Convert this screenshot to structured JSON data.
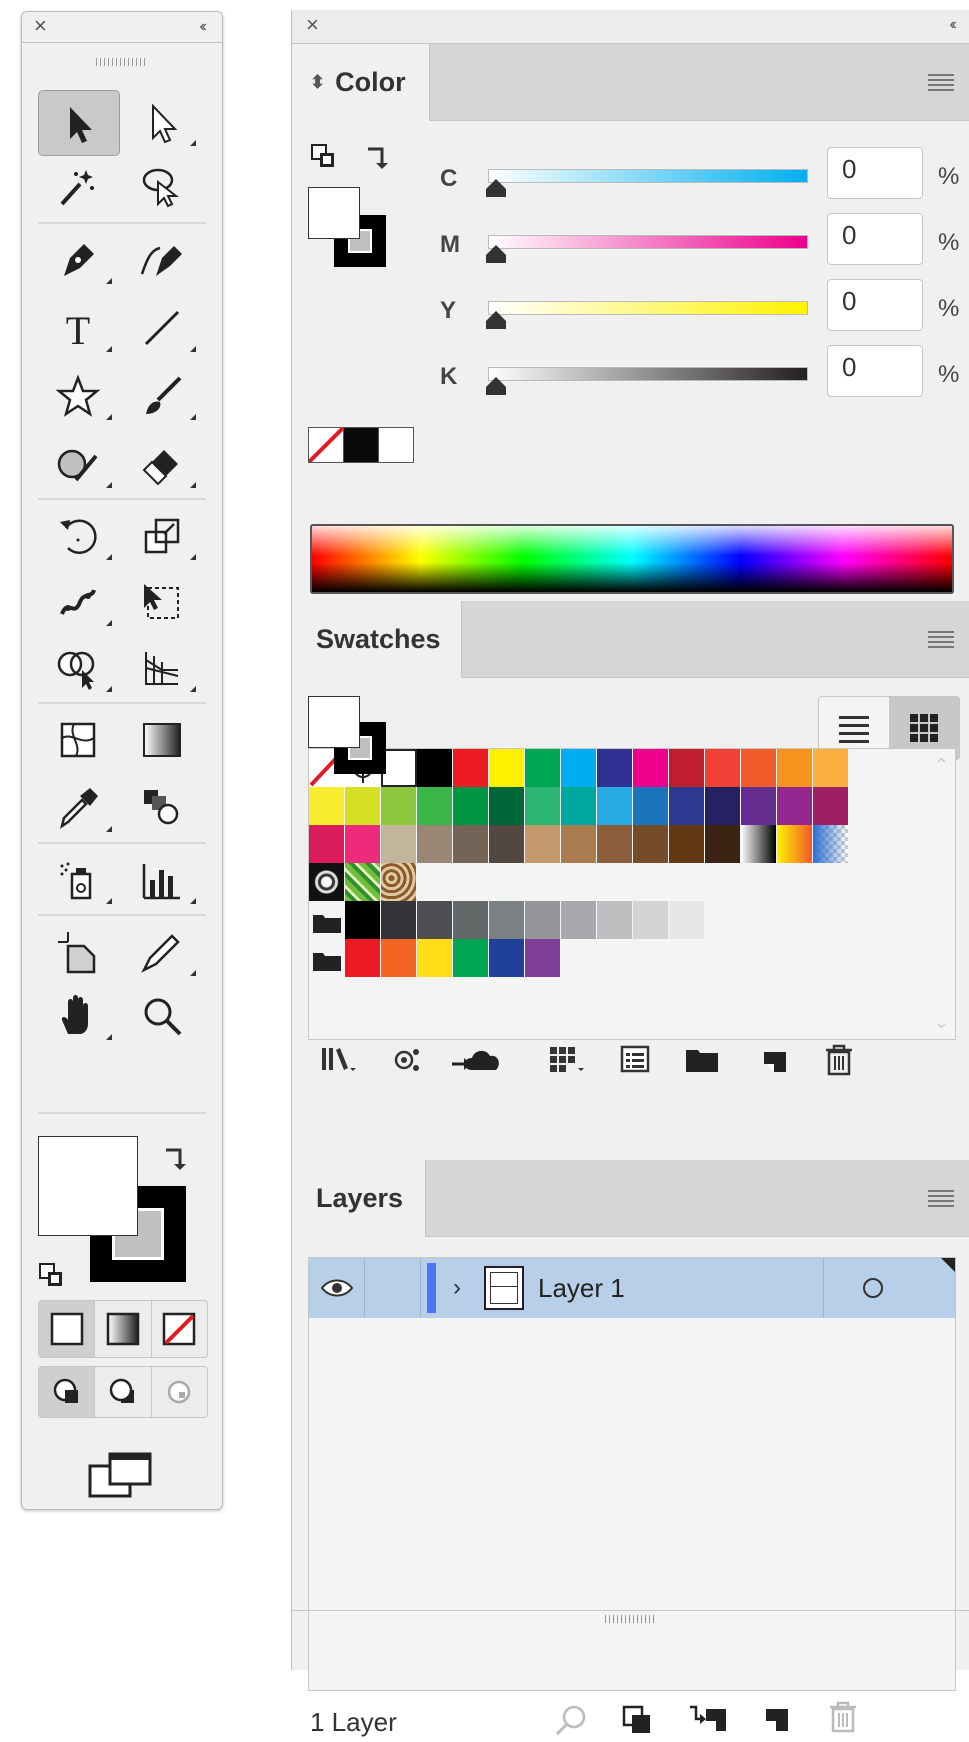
{
  "toolbar": {
    "close": "×",
    "collapse": "‹‹",
    "tools": [
      "selection-tool",
      "direct-selection-tool",
      "magic-wand-tool",
      "lasso-tool",
      "pen-tool",
      "curvature-tool",
      "type-tool",
      "line-segment-tool",
      "star-tool",
      "paintbrush-tool",
      "shaper-tool",
      "eraser-tool",
      "rotate-tool",
      "scale-tool",
      "puppet-warp-tool",
      "free-transform-tool",
      "shape-builder-tool",
      "perspective-grid-tool",
      "mesh-tool",
      "gradient-tool",
      "eyedropper-tool",
      "blend-tool",
      "symbol-sprayer-tool",
      "column-graph-tool",
      "artboard-tool",
      "slice-tool",
      "hand-tool",
      "zoom-tool"
    ]
  },
  "panels": {
    "close": "×",
    "collapse": "‹‹"
  },
  "color": {
    "tab": "Color",
    "channels": [
      {
        "label": "C",
        "value": "0",
        "unit": "%",
        "color": "#00aeef"
      },
      {
        "label": "M",
        "value": "0",
        "unit": "%",
        "color": "#ec008c"
      },
      {
        "label": "Y",
        "value": "0",
        "unit": "%",
        "color": "#fff200"
      },
      {
        "label": "K",
        "value": "0",
        "unit": "%",
        "color": "#231f20"
      }
    ]
  },
  "swatches": {
    "tab": "Swatches",
    "rows": [
      [
        "none",
        "registration",
        "#ffffff",
        "#000000",
        "#ed1c24",
        "#fff200",
        "#00a651",
        "#00aeef",
        "#2e3192",
        "#ec008c",
        "#be1e2d",
        "#ef4136",
        "#f15a29",
        "#f7941d",
        "#fbb040"
      ],
      [
        "#f9ed32",
        "#d7df23",
        "#8dc63f",
        "#39b54a",
        "#009444",
        "#006838",
        "#2bb673",
        "#00a79d",
        "#27aae1",
        "#1c75bc",
        "#2b3990",
        "#262262",
        "#662d91",
        "#92278f",
        "#9e1f63"
      ],
      [
        "#da1c5c",
        "#ee2a7b",
        "#c2b59b",
        "#998675",
        "#736357",
        "#534741",
        "#c49a6c",
        "#a97c50",
        "#8b5e3c",
        "#754c29",
        "#603913",
        "#3c2415",
        "gradient-bw",
        "gradient-orange",
        "transparency"
      ],
      [
        "pattern-dots",
        "pattern-leaves",
        "pattern-swirl"
      ],
      [
        "folder",
        "#000000",
        "#333338",
        "#4d4d52",
        "#636768",
        "#7b8083",
        "#939598",
        "#a7a9ac",
        "#bcbec0",
        "#d1d3d4",
        "#e6e7e8"
      ],
      [
        "folder",
        "#ed1c24",
        "#f26522",
        "#ffde17",
        "#00a651",
        "#21409a",
        "#7f3f98"
      ]
    ]
  },
  "layers": {
    "tab": "Layers",
    "items": [
      {
        "name": "Layer 1",
        "color": "#4a78f0"
      }
    ],
    "count": "1 Layer"
  }
}
